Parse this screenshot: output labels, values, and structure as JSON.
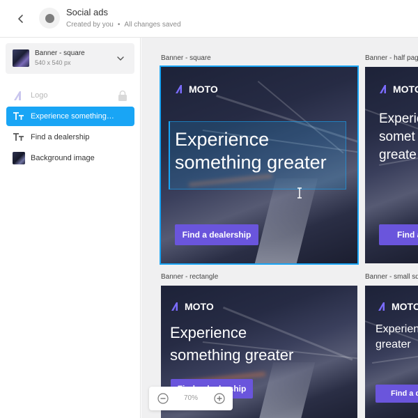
{
  "header": {
    "title": "Social ads",
    "created_by": "Created by you",
    "save_status": "All changes saved"
  },
  "sidebar": {
    "format": {
      "name": "Banner - square",
      "size": "540 x 540 px"
    },
    "layers": [
      {
        "label": "Logo",
        "icon": "logo-icon",
        "locked": true
      },
      {
        "label": "Experience something…",
        "icon": "text-icon",
        "active": true
      },
      {
        "label": "Find a dealership",
        "icon": "text-icon"
      },
      {
        "label": "Background image",
        "icon": "image-thumbnail"
      }
    ]
  },
  "canvas": {
    "frames": [
      {
        "label": "Banner - square",
        "brand": "MOTO",
        "headline_1": "Experience",
        "headline_2": "something greater",
        "cta": "Find a dealership"
      },
      {
        "label": "Banner - half page",
        "brand": "MOTO",
        "headline_1": "Experie",
        "headline_2": "somet",
        "headline_3": "greate",
        "cta": "Find a"
      },
      {
        "label": "Banner - rectangle",
        "brand": "MOTO",
        "headline_1": "Experience",
        "headline_2": "something greater",
        "cta": "Find a dealership"
      },
      {
        "label": "Banner - small sq",
        "brand": "MOTO",
        "headline_1": "Experien",
        "headline_2": "greater",
        "cta": "Find a d"
      }
    ]
  },
  "zoom": {
    "value": "70%"
  },
  "colors": {
    "accent": "#19a5f5",
    "cta": "#6a55dc",
    "banner_dark": "#1d2238"
  }
}
